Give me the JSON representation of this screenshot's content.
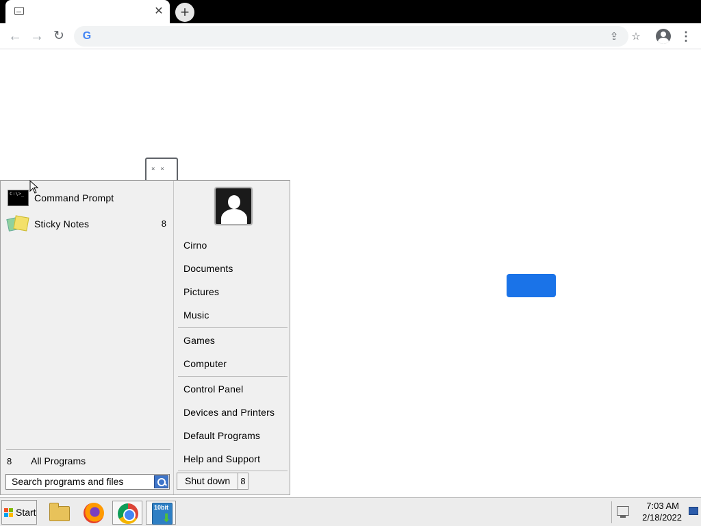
{
  "browser": {
    "tab": {
      "icon": "sad-tab-favicon-icon",
      "close_glyph": "✕"
    },
    "new_tab_glyph": "+",
    "nav": {
      "back_glyph": "←",
      "forward_glyph": "→",
      "reload_glyph": "↻"
    },
    "omnibox": {
      "value": "",
      "icons": [
        "google-icon",
        "share-icon",
        "star-icon"
      ]
    },
    "menu_glyph": "⋮"
  },
  "start_menu": {
    "programs": [
      {
        "label": "Command Prompt",
        "icon": "command-prompt-icon",
        "arrow": ""
      },
      {
        "label": "Sticky Notes",
        "icon": "sticky-notes-icon",
        "arrow": "8"
      }
    ],
    "all_programs": {
      "arrow": "8",
      "label": "All Programs"
    },
    "search": {
      "placeholder": "Search programs and files"
    },
    "right_items": [
      "Cirno",
      "Documents",
      "Pictures",
      "Music",
      "Games",
      "Computer",
      "Control Panel",
      "Devices and Printers",
      "Default Programs",
      "Help and Support"
    ],
    "shutdown": {
      "label": "Shut down",
      "arrow": "8"
    }
  },
  "taskbar": {
    "start_label": "Start",
    "pinned": [
      "file-explorer-icon",
      "firefox-icon",
      "chrome-icon",
      "download-manager-icon"
    ],
    "download_manager_badge": "10bit",
    "clock": {
      "time": "7:03 AM",
      "date": "2/18/2022"
    }
  },
  "colors": {
    "accent_button": "#1a73e8",
    "start_menu_bg": "#f0f0f0",
    "taskbar_bg": "#ececec"
  }
}
